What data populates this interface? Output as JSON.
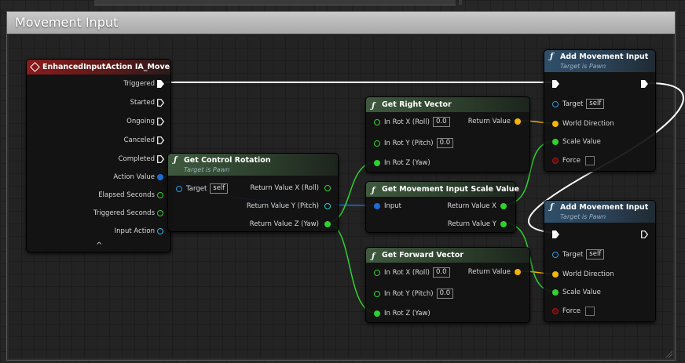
{
  "comment": {
    "title": "Movement Input"
  },
  "nodes": {
    "ia_move": {
      "title": "EnhancedInputAction IA_Move",
      "outputs": [
        "Triggered",
        "Started",
        "Ongoing",
        "Canceled",
        "Completed",
        "Action Value",
        "Elapsed Seconds",
        "Triggered Seconds",
        "Input Action"
      ],
      "collapse_glyph": "^"
    },
    "get_control_rotation": {
      "title": "Get Control Rotation",
      "subtitle": "Target is Pawn",
      "target_label": "Target",
      "target_value": "self",
      "outputs": [
        "Return Value X (Roll)",
        "Return Value Y (Pitch)",
        "Return Value Z (Yaw)"
      ]
    },
    "get_right_vector": {
      "title": "Get Right Vector",
      "inputs": [
        {
          "label": "In Rot X (Roll)",
          "value": "0.0"
        },
        {
          "label": "In Rot Y (Pitch)",
          "value": "0.0"
        },
        {
          "label": "In Rot Z (Yaw)",
          "value": ""
        }
      ],
      "output": "Return Value"
    },
    "get_movement_input_scale_value": {
      "title": "Get Movement Input Scale Value",
      "input": "Input",
      "outputs": [
        "Return Value X",
        "Return Value Y"
      ]
    },
    "get_forward_vector": {
      "title": "Get Forward Vector",
      "inputs": [
        {
          "label": "In Rot X (Roll)",
          "value": "0.0"
        },
        {
          "label": "In Rot Y (Pitch)",
          "value": "0.0"
        },
        {
          "label": "In Rot Z (Yaw)",
          "value": ""
        }
      ],
      "output": "Return Value"
    },
    "add_movement_input_1": {
      "title": "Add Movement Input",
      "subtitle": "Target is Pawn",
      "target_label": "Target",
      "target_value": "self",
      "world_direction": "World Direction",
      "scale_value": "Scale Value",
      "force": "Force"
    },
    "add_movement_input_2": {
      "title": "Add Movement Input",
      "subtitle": "Target is Pawn",
      "target_label": "Target",
      "target_value": "self",
      "world_direction": "World Direction",
      "scale_value": "Scale Value",
      "force": "Force"
    }
  },
  "colors": {
    "exec": "#ffffff",
    "vector": "#f2b600",
    "float": "#30d030",
    "struct": "#1a6cd6",
    "object": "#2a9ae0",
    "bool": "#a01818"
  }
}
